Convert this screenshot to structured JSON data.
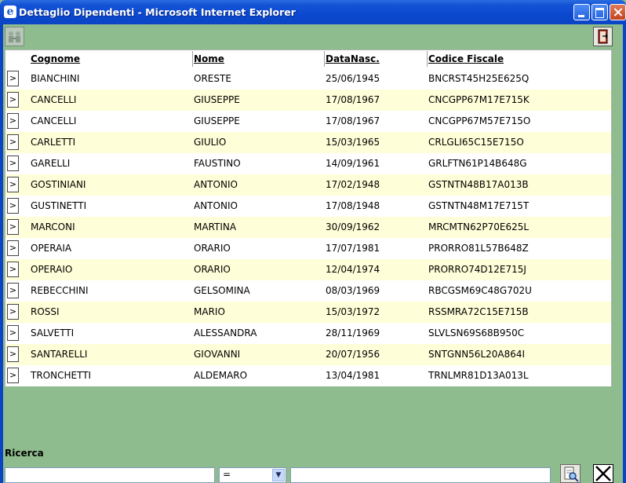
{
  "window": {
    "title": "Dettaglio Dipendenti - Microsoft Internet Explorer",
    "app_icon": "ie-icon"
  },
  "toolbar": {
    "search_icon": "search-people-icon",
    "exit_icon": "exit-door-icon"
  },
  "table": {
    "columns": [
      "Cognome",
      "Nome",
      "DataNasc.",
      "Codice Fiscale"
    ],
    "row_button_label": ">",
    "rows": [
      [
        "BIANCHINI",
        "ORESTE",
        "25/06/1945",
        "BNCRST45H25E625Q"
      ],
      [
        "CANCELLI",
        "GIUSEPPE",
        "17/08/1967",
        "CNCGPP67M17E715K"
      ],
      [
        "CANCELLI",
        "GIUSEPPE",
        "17/08/1967",
        "CNCGPP67M57E715O"
      ],
      [
        "CARLETTI",
        "GIULIO",
        "15/03/1965",
        "CRLGLI65C15E715O"
      ],
      [
        "GARELLI",
        "FAUSTINO",
        "14/09/1961",
        "GRLFTN61P14B648G"
      ],
      [
        "GOSTINIANI",
        "ANTONIO",
        "17/02/1948",
        "GSTNTN48B17A013B"
      ],
      [
        "GUSTINETTI",
        "ANTONIO",
        "17/08/1948",
        "GSTNTN48M17E715T"
      ],
      [
        "MARCONI",
        "MARTINA",
        "30/09/1962",
        "MRCMTN62P70E625L"
      ],
      [
        "OPERAIA",
        "ORARIO",
        "17/07/1981",
        "PRORRO81L57B648Z"
      ],
      [
        "OPERAIO",
        "ORARIO",
        "12/04/1974",
        "PRORRO74D12E715J"
      ],
      [
        "REBECCHINI",
        "GELSOMINA",
        "08/03/1969",
        "RBCGSM69C48G702U"
      ],
      [
        "ROSSI",
        "MARIO",
        "15/03/1972",
        "RSSMRA72C15E715B"
      ],
      [
        "SALVETTI",
        "ALESSANDRA",
        "28/11/1969",
        "SLVLSN69S68B950C"
      ],
      [
        "SANTARELLI",
        "GIOVANNI",
        "20/07/1956",
        "SNTGNN56L20A864I"
      ],
      [
        "TRONCHETTI",
        "ALDEMARO",
        "13/04/1981",
        "TRNLMR81D13A013L"
      ]
    ]
  },
  "search": {
    "label": "Ricerca",
    "field_value": "",
    "operator_value": "=",
    "value": ""
  },
  "colors": {
    "background": "#8fbc8f",
    "row_alt": "#fefed8",
    "titlebar": "#0b45c4"
  }
}
